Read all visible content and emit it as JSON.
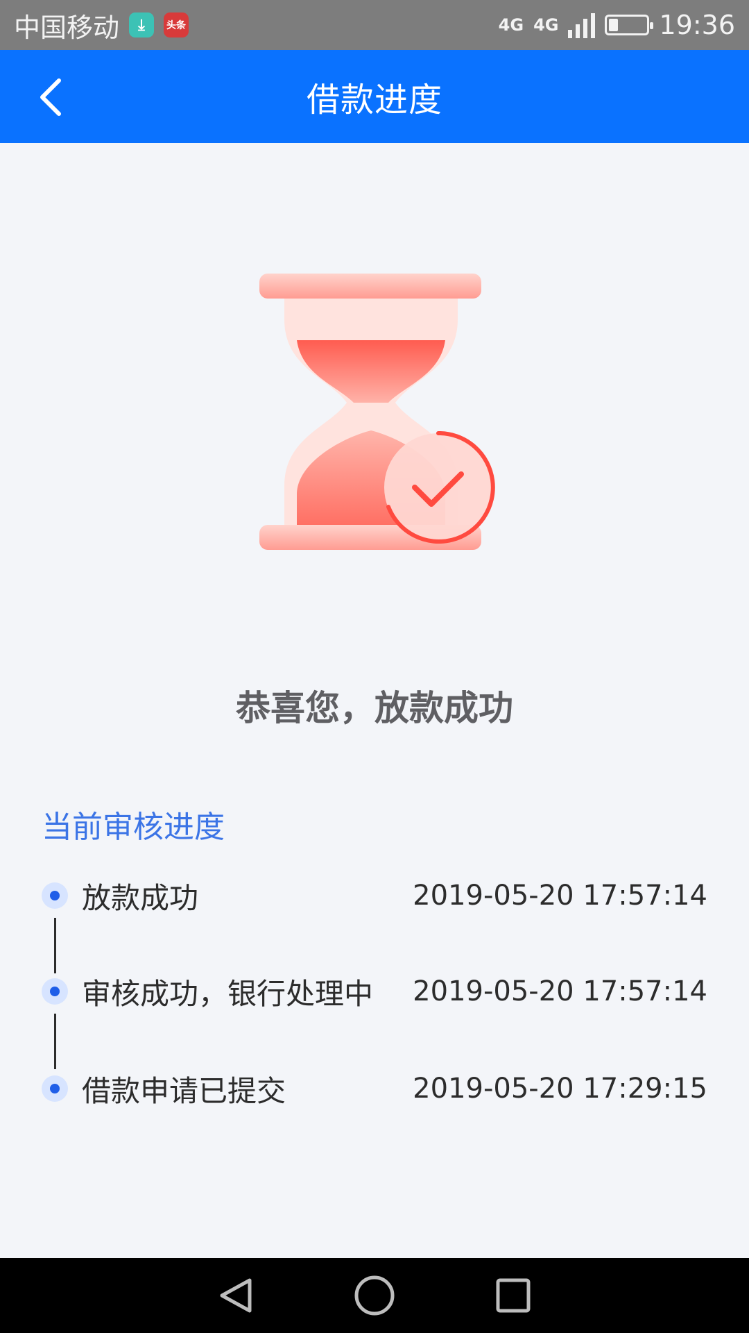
{
  "status_bar": {
    "carrier": "中国移动",
    "news_badge": "头条",
    "network_1": "4G",
    "network_2": "4G",
    "time": "19:36",
    "battery_level_percent": 25
  },
  "app_bar": {
    "title": "借款进度",
    "back_icon": "chevron-left-icon"
  },
  "hero": {
    "icon": "hourglass-check-icon",
    "colors": {
      "primary": "#ff5a4f",
      "light": "#ffb3ab"
    }
  },
  "result": {
    "message": "恭喜您，放款成功"
  },
  "progress": {
    "heading": "当前审核进度",
    "steps": [
      {
        "label": "放款成功",
        "time": "2019-05-20 17:57:14"
      },
      {
        "label": "审核成功，银行处理中",
        "time": "2019-05-20 17:57:14"
      },
      {
        "label": "借款申请已提交",
        "time": "2019-05-20 17:29:15"
      }
    ]
  },
  "nav_bar": {
    "back": "triangle-back-icon",
    "home": "circle-home-icon",
    "recents": "square-recents-icon"
  },
  "colors": {
    "brand_blue": "#0a72ff",
    "heading_blue": "#3b74e6",
    "dot_blue": "#1f5ee8",
    "background": "#f3f5f9"
  }
}
